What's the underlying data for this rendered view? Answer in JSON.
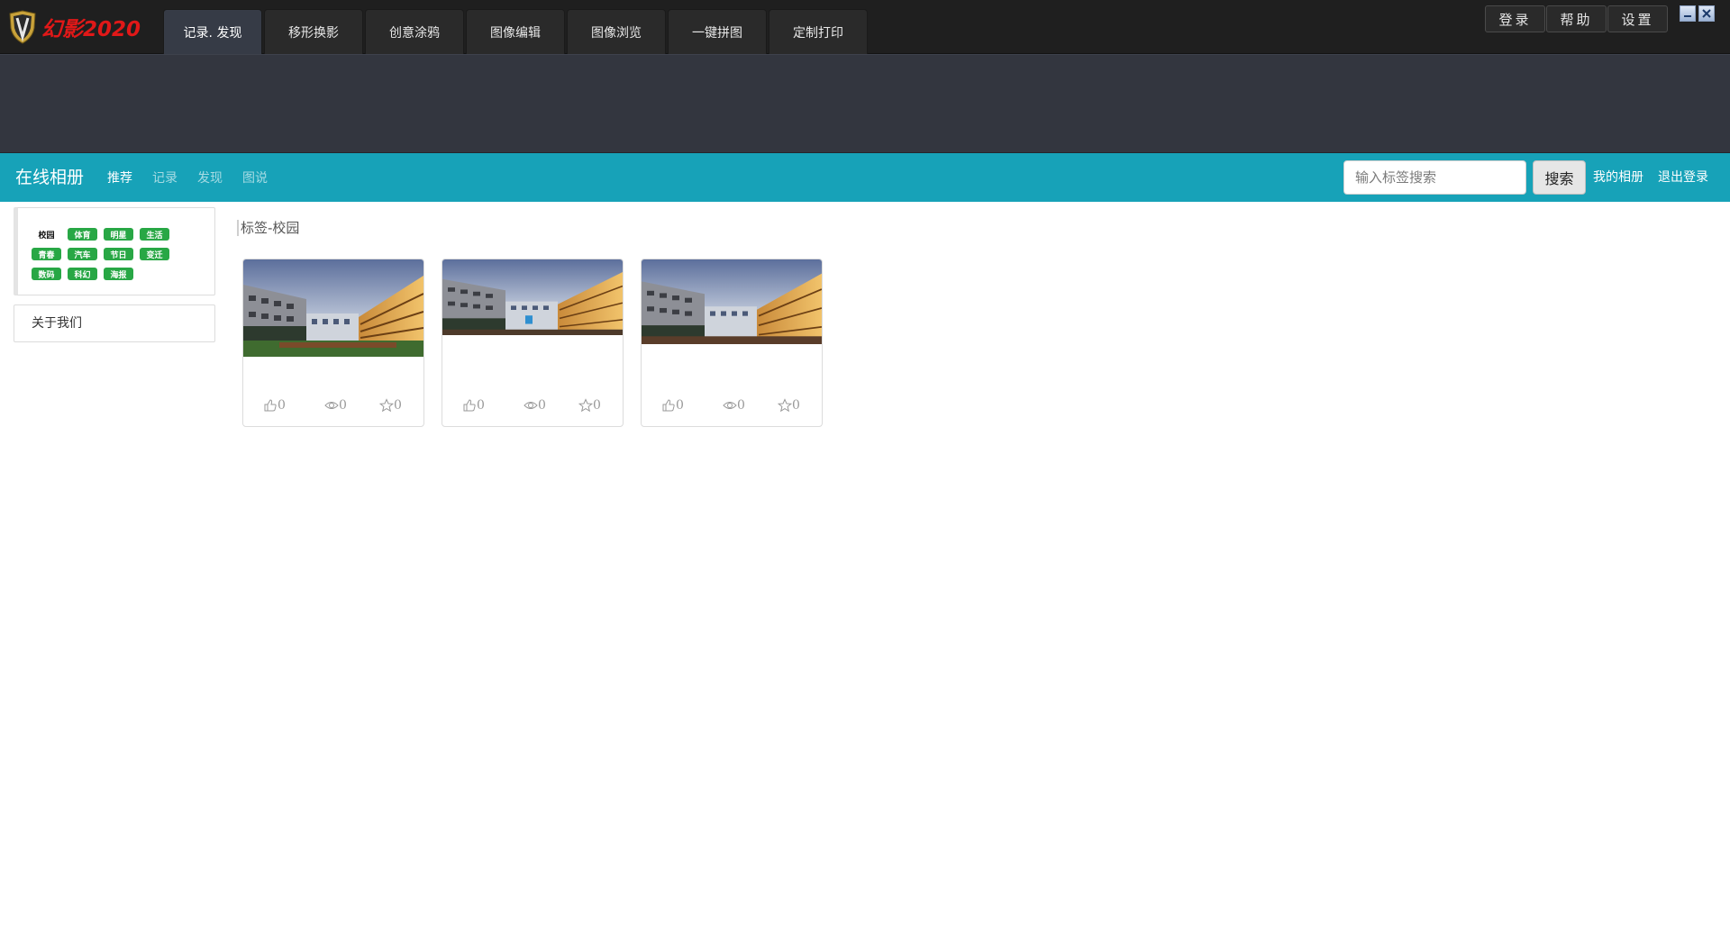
{
  "app": {
    "logo_text": "幻影2020",
    "tabs": [
      {
        "label": "记录. 发现"
      },
      {
        "label": "移形换影"
      },
      {
        "label": "创意涂鸦"
      },
      {
        "label": "图像编辑"
      },
      {
        "label": "图像浏览"
      },
      {
        "label": "一键拼图"
      },
      {
        "label": "定制打印"
      }
    ],
    "top_buttons": [
      {
        "label": "登录"
      },
      {
        "label": "帮助"
      },
      {
        "label": "设置"
      }
    ]
  },
  "navbar": {
    "brand": "在线相册",
    "links": [
      {
        "label": "推荐"
      },
      {
        "label": "记录"
      },
      {
        "label": "发现"
      },
      {
        "label": "图说"
      }
    ],
    "search_placeholder": "输入标签搜索",
    "search_button": "搜索",
    "my_album": "我的相册",
    "logout": "退出登录"
  },
  "sidebar": {
    "tags": [
      [
        "校园",
        "体育",
        "明星",
        "生活"
      ],
      [
        "青春",
        "汽车",
        "节日",
        "变迁"
      ],
      [
        "数码",
        "科幻",
        "海报"
      ]
    ],
    "about": "关于我们"
  },
  "main": {
    "breadcrumb": "标签-校园",
    "cards": [
      {
        "likes": "0",
        "views": "0",
        "favorites": "0"
      },
      {
        "likes": "0",
        "views": "0",
        "favorites": "0"
      },
      {
        "likes": "0",
        "views": "0",
        "favorites": "0"
      }
    ]
  },
  "icons": {
    "logo": "shield-logo-icon",
    "minimize": "minimize-icon",
    "close": "close-icon",
    "like": "thumbs-up-icon",
    "view": "eye-icon",
    "favorite": "star-icon"
  },
  "colors": {
    "navbar": "#17a2b8",
    "tag": "#28a745",
    "logo_text": "#e01818",
    "titlebar": "#1f1f1f",
    "banner": "#33363f"
  }
}
